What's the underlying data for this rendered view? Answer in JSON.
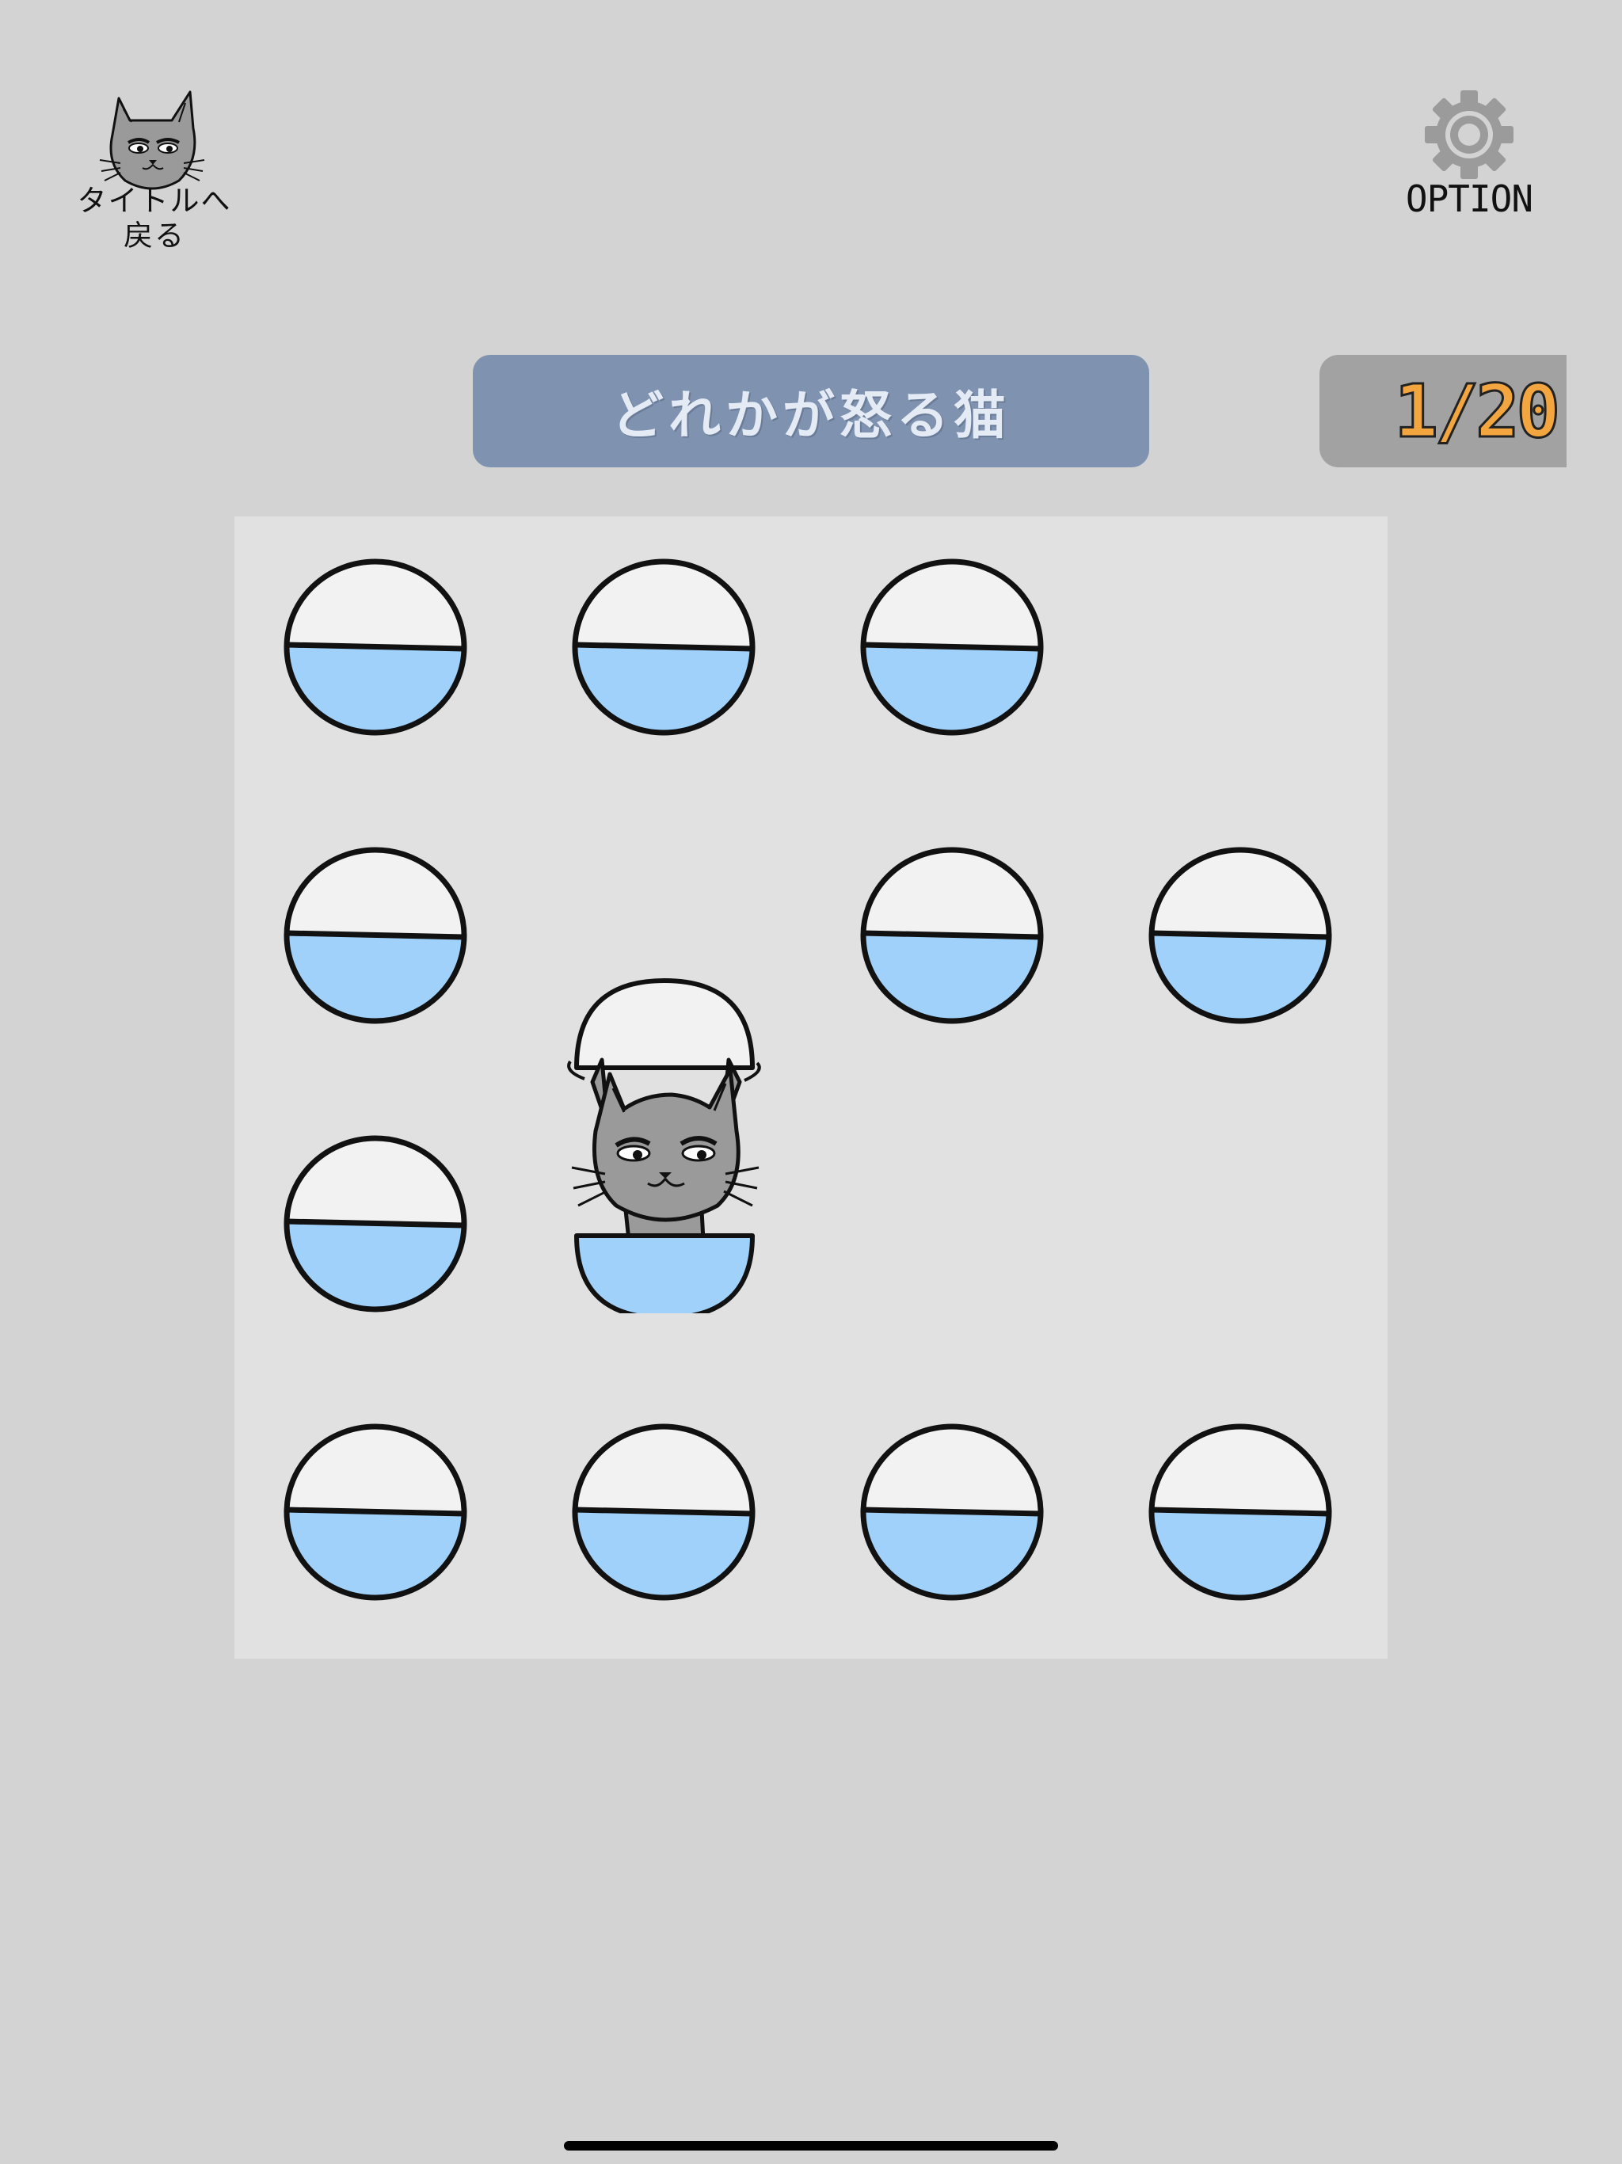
{
  "header": {
    "back_label": "タイトルへ戻る",
    "back_icon": "grumpy-cat-icon",
    "option_label": "OPTION",
    "option_icon": "gear-icon"
  },
  "game": {
    "title": "どれかが怒る猫",
    "counter": "1/20"
  },
  "board": {
    "rows": 4,
    "cols": 4,
    "cells": [
      [
        "capsule",
        "capsule",
        "capsule",
        "empty"
      ],
      [
        "capsule",
        "empty",
        "capsule",
        "capsule"
      ],
      [
        "capsule",
        "opened-cat",
        "empty",
        "empty"
      ],
      [
        "capsule",
        "capsule",
        "capsule",
        "capsule"
      ]
    ]
  },
  "colors": {
    "background": "#d3d3d3",
    "board": "#e1e1e1",
    "banner": "#7f93b1",
    "banner_text": "#e5ebf5",
    "counter_bg": "#a2a2a2",
    "counter_text": "#f3a640",
    "capsule_top": "#f2f2f2",
    "capsule_bottom": "#9fd1fa",
    "cat_fur": "#9a9a9a"
  }
}
